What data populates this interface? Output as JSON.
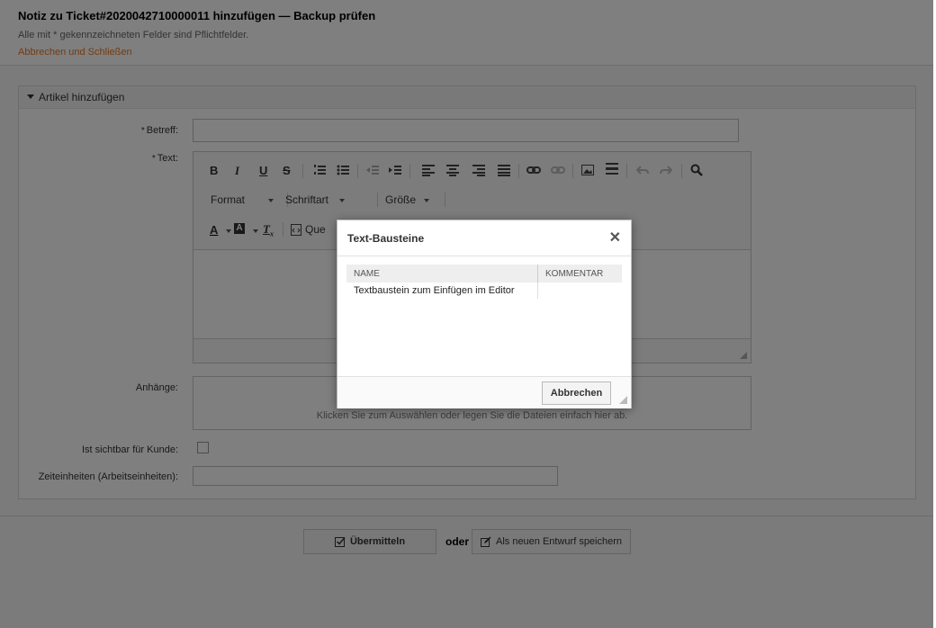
{
  "header": {
    "title": "Notiz zu Ticket#2020042710000011 hinzufügen — Backup prüfen",
    "hint": "Alle mit * gekennzeichneten Felder sind Pflichtfelder.",
    "cancel_link": "Abbrechen und Schließen"
  },
  "widget": {
    "title": "Artikel hinzufügen"
  },
  "form": {
    "subject_label": "Betreff:",
    "subject_value": "",
    "text_label": "Text:",
    "required_mark": "*",
    "attachments_label": "Anhänge:",
    "dropzone_text": "Klicken Sie zum Auswählen oder legen Sie die Dateien einfach hier ab.",
    "visible_label": "Ist sichtbar für Kunde:",
    "time_label": "Zeiteinheiten (Arbeitseinheiten):",
    "time_value": ""
  },
  "editor": {
    "format": "Format",
    "font": "Schriftart",
    "size": "Größe",
    "source_partial": "Que",
    "btn_bold": "B",
    "btn_italic": "I",
    "btn_underline": "U",
    "btn_strike": "S",
    "btn_text_color": "A",
    "btn_bg_color": "A",
    "btn_remove_format": "T",
    "remove_format_sub": "x",
    "icons": [
      "bold-icon",
      "italic-icon",
      "underline-icon",
      "strikethrough-icon",
      "numbered-list-icon",
      "bulleted-list-icon",
      "outdent-icon",
      "indent-icon",
      "align-left-icon",
      "align-center-icon",
      "align-right-icon",
      "justify-icon",
      "link-icon",
      "unlink-icon",
      "image-icon",
      "horizontal-rule-icon",
      "undo-icon",
      "redo-icon",
      "search-icon",
      "text-color-icon",
      "background-color-icon",
      "remove-format-icon",
      "source-icon"
    ]
  },
  "footer": {
    "submit": "Übermitteln",
    "or": "oder",
    "draft": "Als neuen Entwurf speichern"
  },
  "dialog": {
    "title": "Text-Bausteine",
    "close_glyph": "✕",
    "columns": [
      "NAME",
      "KOMMENTAR"
    ],
    "rows": [
      {
        "name": "Textbaustein zum Einfügen im Editor",
        "comment": ""
      }
    ],
    "cancel": "Abbrechen"
  },
  "colors": {
    "accent_link": "#e87722",
    "overlay": "rgba(0,0,0,0.5)"
  }
}
